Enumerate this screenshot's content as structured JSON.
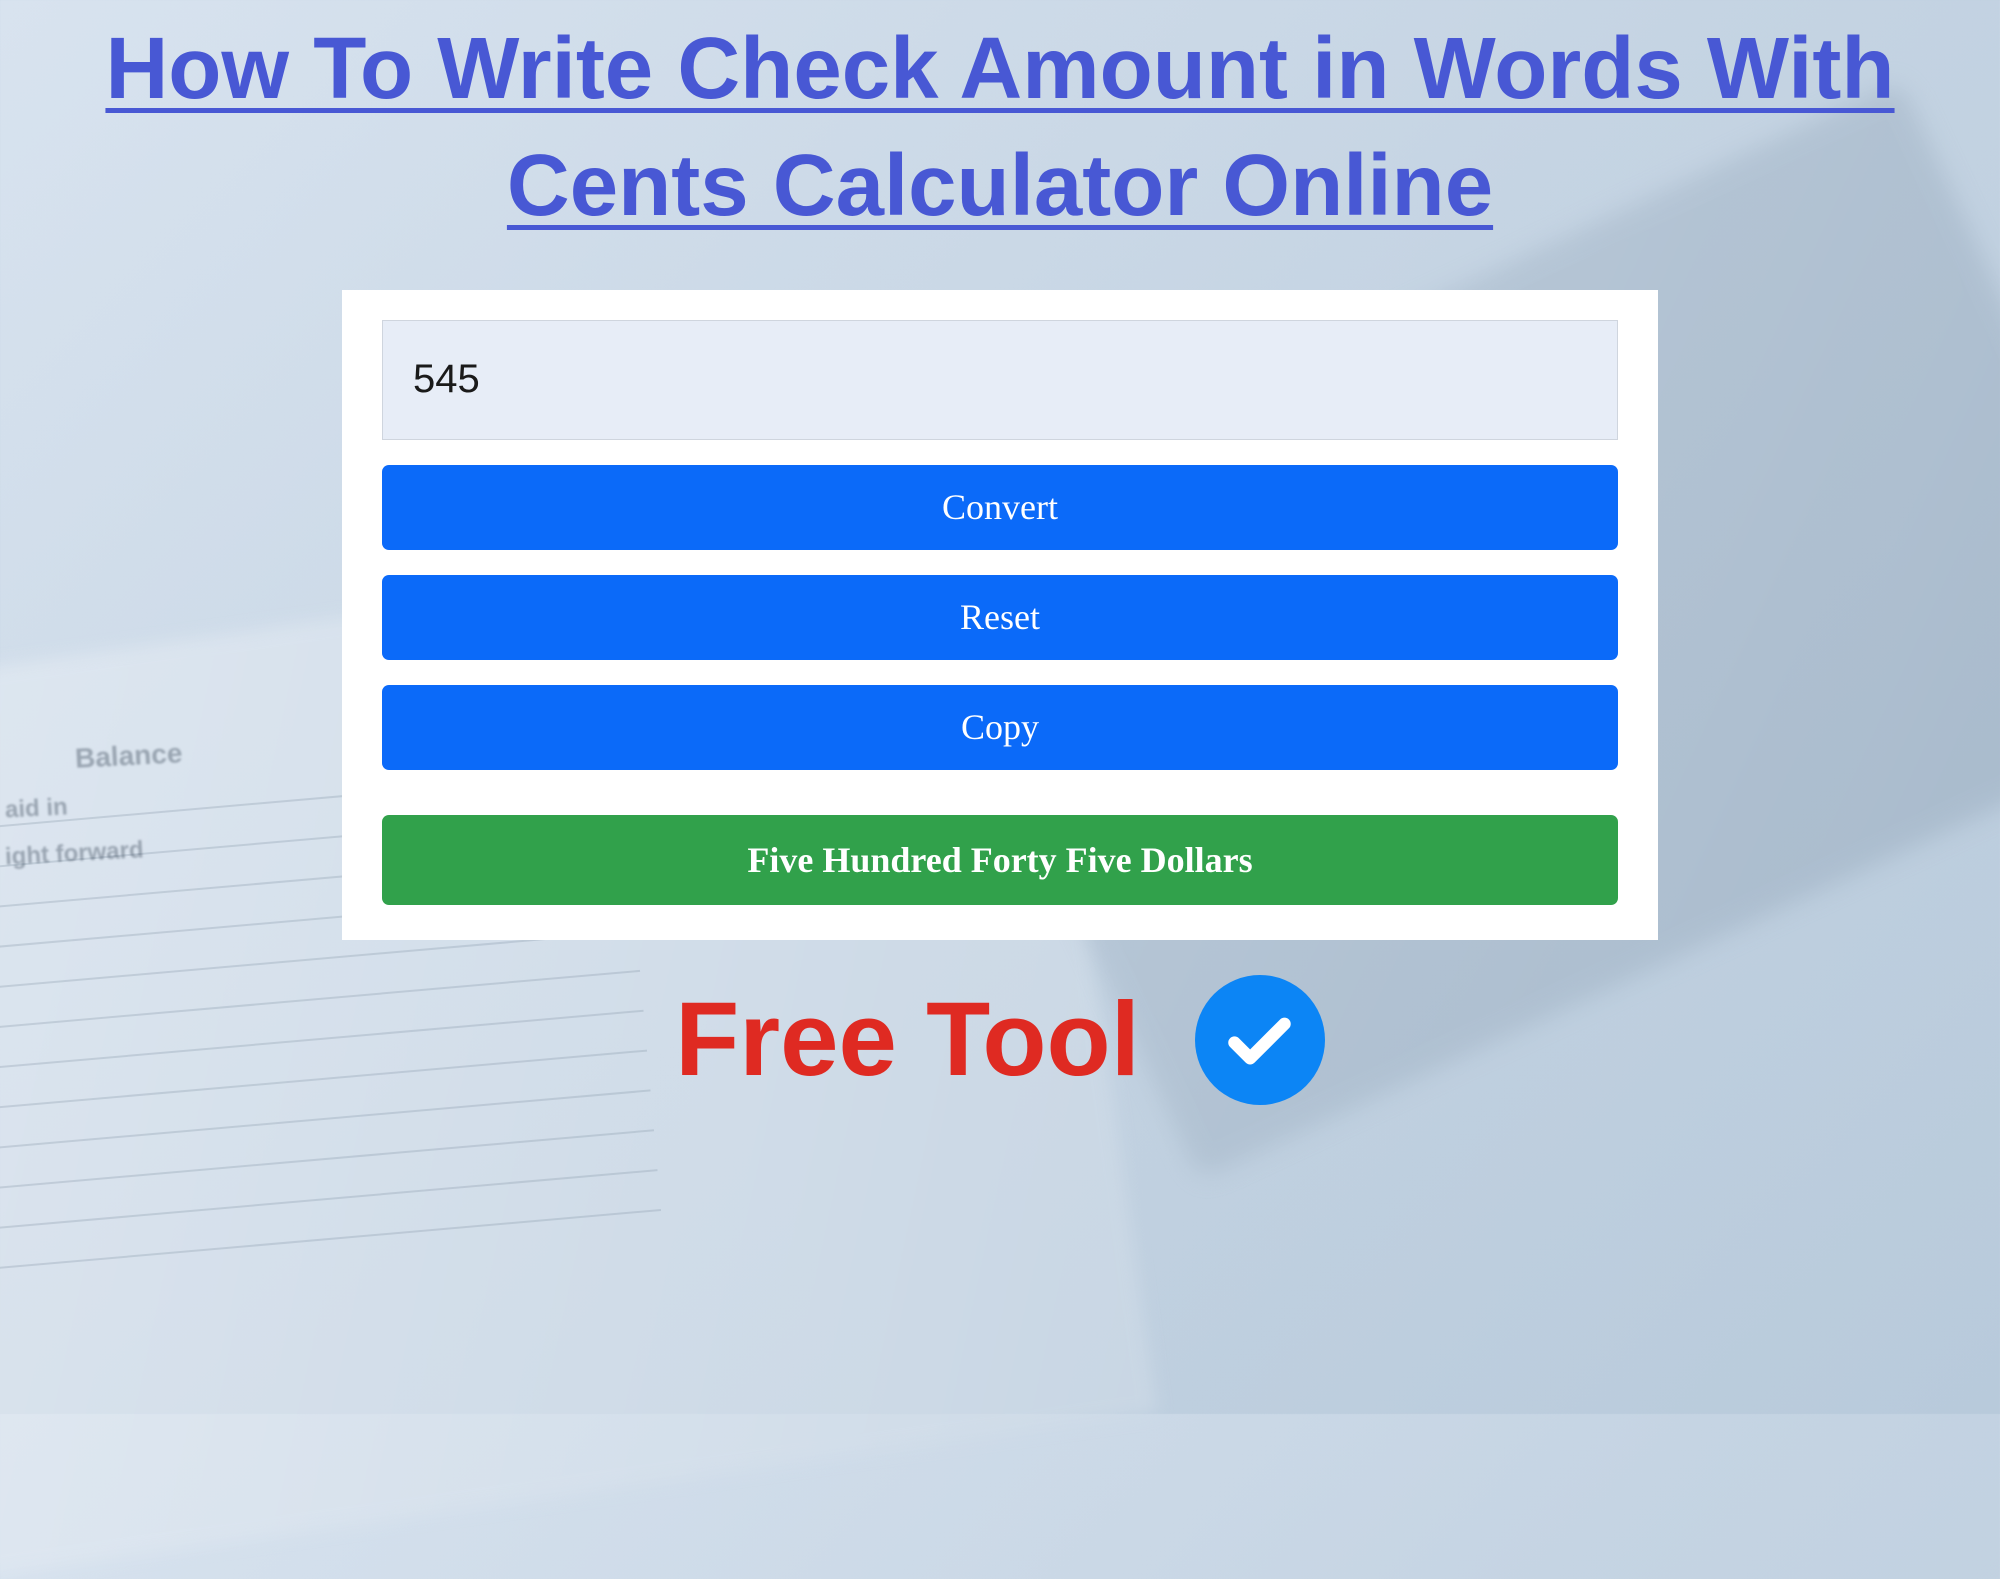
{
  "header": {
    "title": "How To Write Check Amount in Words With Cents Calculator Online"
  },
  "calculator": {
    "input_value": "545",
    "input_placeholder": "",
    "convert_label": "Convert",
    "reset_label": "Reset",
    "copy_label": "Copy",
    "result_text": "Five Hundred Forty Five Dollars"
  },
  "footer": {
    "free_tool_label": "Free Tool",
    "check_icon": "check-icon"
  },
  "background": {
    "balance_label": "Balance",
    "paid_label": "aid in",
    "forward_label": "ight forward"
  },
  "colors": {
    "title": "#4858d4",
    "button_blue": "#0b6af9",
    "button_green": "#31a14b",
    "free_tool": "#df2a22",
    "badge": "#0c85f5"
  }
}
